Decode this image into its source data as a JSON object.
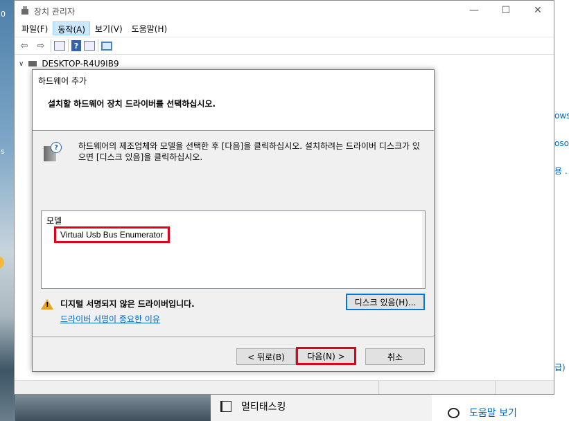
{
  "desktop": {
    "fragments": [
      "0",
      "s"
    ]
  },
  "settings_bg": {
    "fragments": [
      "ows",
      "osof",
      "용 .",
      "급)"
    ]
  },
  "bottom": {
    "multitasking_label": "멀티태스킹",
    "help_label": "도움말 보기"
  },
  "window": {
    "title": "장치 관리자",
    "controls": {
      "minimize": "—",
      "maximize": "☐",
      "close": "✕"
    },
    "menu": [
      {
        "label": "파일(F)",
        "active": false
      },
      {
        "label": "동작(A)",
        "active": true
      },
      {
        "label": "보기(V)",
        "active": false
      },
      {
        "label": "도움말(H)",
        "active": false
      }
    ],
    "toolbar_icons": [
      "back-arrow-icon",
      "forward-arrow-icon",
      "properties-icon",
      "help-icon",
      "device-panel-icon",
      "monitor-icon"
    ],
    "tree_root": "DESKTOP-R4U9IB9"
  },
  "dialog": {
    "title": "하드웨어 추가",
    "heading": "설치할 하드웨어 장치 드라이버를 선택하십시오.",
    "info_text": "하드웨어의 제조업체와 모델을 선택한 후 [다음]을 클릭하십시오. 설치하려는 드라이버 디스크가 있으면 [디스크 있음]을 클릭하십시오.",
    "model_header": "모델",
    "model_items": [
      "Virtual Usb Bus Enumerator"
    ],
    "warning_text": "디지털 서명되지 않은 드라이버입니다.",
    "warning_link": "드라이버 서명이 중요한 이유",
    "buttons": {
      "disk": "디스크 있음(H)...",
      "back": "< 뒤로(B)",
      "next": "다음(N) >",
      "cancel": "취소"
    },
    "accent_colors": {
      "highlight_box": "#e0001b",
      "link": "#0066cc",
      "focus": "#0078d7"
    }
  }
}
